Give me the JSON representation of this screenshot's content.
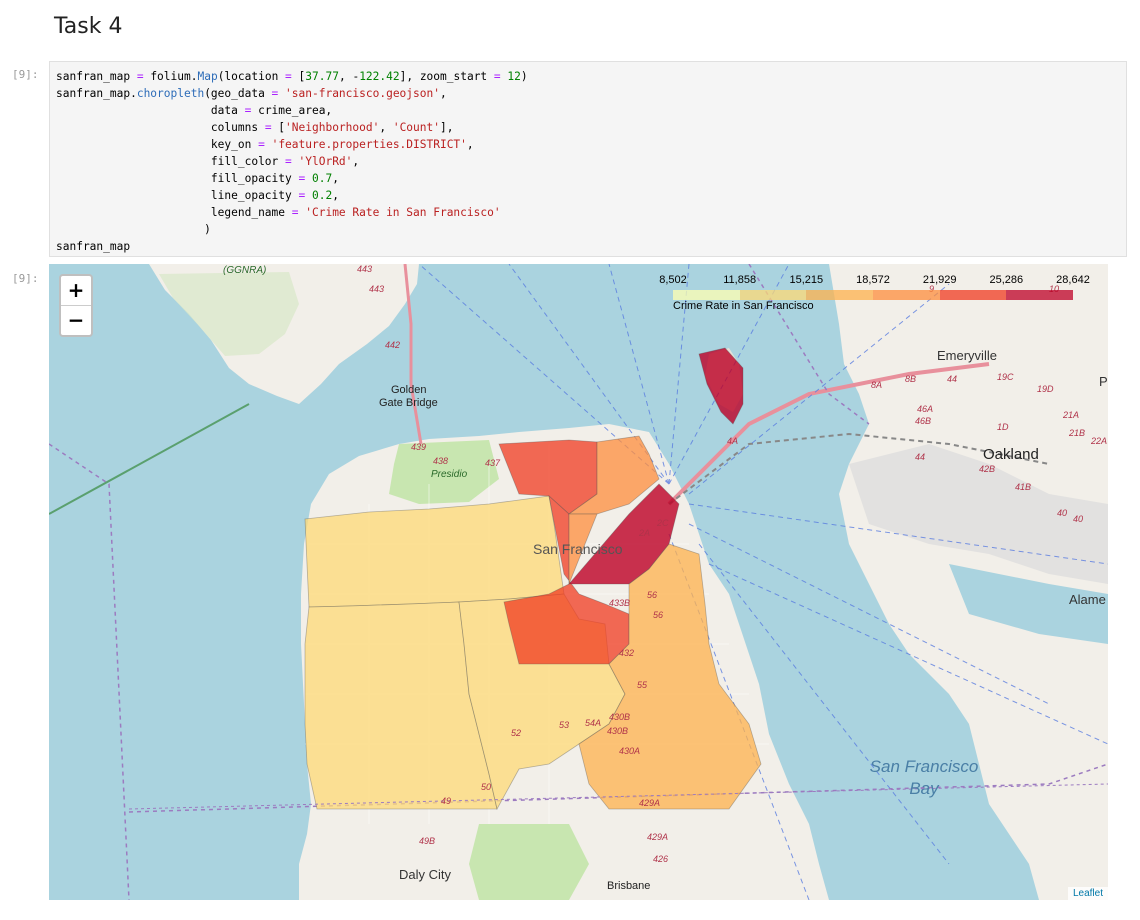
{
  "heading": "Task 4",
  "cell_input_prompt": "[9]:",
  "cell_output_prompt": "[9]:",
  "code_lines": [
    "sanfran_map = folium.Map(location = [37.77, -122.42], zoom_start = 12)",
    "sanfran_map.choropleth(geo_data = 'san-francisco.geojson',",
    "                       data = crime_area,",
    "                       columns = ['Neighborhood', 'Count'],",
    "                       key_on = 'feature.properties.DISTRICT',",
    "                       fill_color = 'YlOrRd',",
    "                       fill_opacity = 0.7,",
    "                       line_opacity = 0.2,",
    "                       legend_name = 'Crime Rate in San Francisco'",
    "                      )",
    "sanfran_map"
  ],
  "map": {
    "zoom_in": "+",
    "zoom_out": "−",
    "attribution": "Leaflet",
    "legend": {
      "title": "Crime Rate in San Francisco",
      "ticks": [
        "8,502",
        "11,858",
        "15,215",
        "18,572",
        "21,929",
        "25,286",
        "28,642"
      ],
      "colors": [
        "#ffffb2",
        "#fed976",
        "#feb24c",
        "#fd8d3c",
        "#f03b20",
        "#bd0026"
      ]
    },
    "labels": {
      "ggnra": "(GGNRA)",
      "golden_gate_1": "Golden",
      "golden_gate_2": "Gate Bridge",
      "presidio": "Presidio",
      "san_francisco": "San Francisco",
      "emeryville": "Emeryville",
      "oakland": "Oakland",
      "alameda": "Alame",
      "pi": "Pi",
      "sf_bay_1": "San Francisco",
      "sf_bay_2": "Bay",
      "daly_city": "Daly City",
      "brisbane": "Brisbane"
    },
    "routes": [
      "443",
      "443",
      "442",
      "439",
      "438",
      "437",
      "4A",
      "8A",
      "8B",
      "44",
      "19C",
      "19D",
      "46A",
      "46B",
      "1D",
      "42B",
      "41B",
      "40",
      "40",
      "21A",
      "21B",
      "22A",
      "44",
      "2A",
      "2C",
      "56",
      "56",
      "433B",
      "432",
      "55",
      "54A",
      "430B",
      "430B",
      "430A",
      "53",
      "52",
      "50",
      "49",
      "429A",
      "429A",
      "49B",
      "426",
      "9",
      "10"
    ]
  }
}
